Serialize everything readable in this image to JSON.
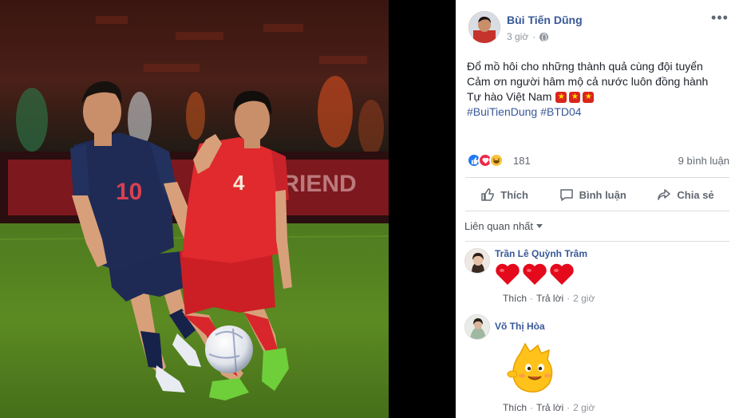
{
  "post": {
    "author": "Bùi Tiến Dũng",
    "time": "3 giờ",
    "lines": [
      "Đổ mồ hôi cho những thành quả cùng đội tuyển",
      "Cảm ơn người hâm mộ cả nước luôn đồng hành",
      "Tự hào Việt Nam"
    ],
    "hashtags": [
      "#BuiTienDung",
      "#BTD04"
    ],
    "reaction_count": "181",
    "comment_count": "9 bình luận",
    "more_icon": "more-dots-icon",
    "privacy_icon": "globe-icon"
  },
  "photo": {
    "player_red_number": "4",
    "player_blue_number": "10",
    "ad_board_text": "FRIEND"
  },
  "actions": {
    "like": "Thích",
    "comment": "Bình luận",
    "share": "Chia sẻ"
  },
  "sort_label": "Liên quan nhất",
  "comments": [
    {
      "name": "Trần Lê Quỳnh Trâm",
      "content": "hearts",
      "like": "Thích",
      "dot1": "·",
      "reply": "Trả lời",
      "dot2": "·",
      "time": "2 giờ"
    },
    {
      "name": "Võ Thị Hòa",
      "content": "sticker",
      "like": "Thích",
      "dot1": "·",
      "reply": "Trả lời",
      "dot2": "·",
      "time": "2 giờ"
    }
  ],
  "colors": {
    "link_blue": "#385898",
    "like_blue": "#2078f4",
    "love_red": "#f0284a",
    "vietnam_red": "#da251d",
    "thai_navy": "#1f2b55"
  }
}
